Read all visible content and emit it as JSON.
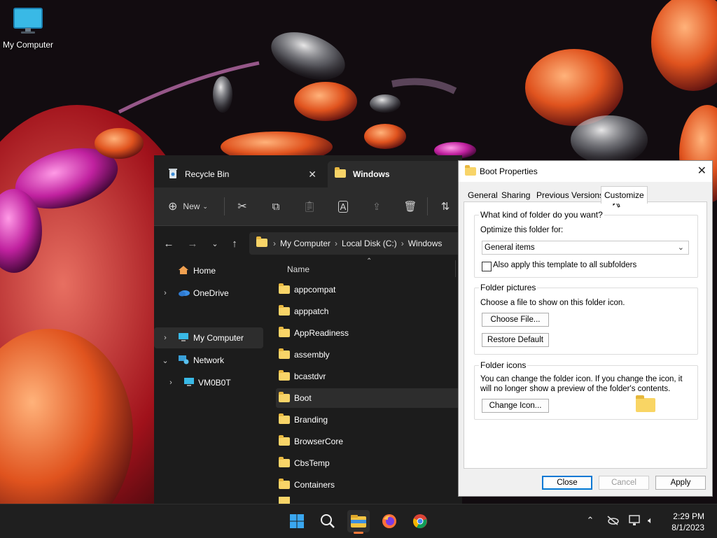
{
  "desktop": {
    "icon_label": "My Computer"
  },
  "explorer": {
    "tabs": [
      {
        "label": "Recycle Bin"
      },
      {
        "label": "Windows"
      }
    ],
    "toolbar": {
      "new_label": "New"
    },
    "address": {
      "crumbs": [
        "My Computer",
        "Local Disk (C:)",
        "Windows"
      ]
    },
    "nav": {
      "home": "Home",
      "onedrive": "OneDrive",
      "mycomputer": "My Computer",
      "network": "Network",
      "vm": "VM0B0T"
    },
    "list": {
      "header": "Name",
      "items": [
        "appcompat",
        "apppatch",
        "AppReadiness",
        "assembly",
        "bcastdvr",
        "Boot",
        "Branding",
        "BrowserCore",
        "CbsTemp",
        "Containers"
      ],
      "selected": "Boot"
    }
  },
  "dialog": {
    "title": "Boot Properties",
    "tabs": [
      "General",
      "Sharing",
      "Previous Versions",
      "Customize"
    ],
    "active_tab": "Customize",
    "type_group": {
      "label": "What kind of folder do you want?",
      "optimize_label": "Optimize this folder for:",
      "select_value": "General items",
      "checkbox_label": "Also apply this template to all subfolders",
      "checkbox_checked": false
    },
    "pictures_group": {
      "label": "Folder pictures",
      "desc": "Choose a file to show on this folder icon.",
      "choose_btn": "Choose File...",
      "restore_btn": "Restore Default"
    },
    "icons_group": {
      "label": "Folder icons",
      "desc": "You can change the folder icon. If you change the icon, it will no longer show a preview of the folder's contents.",
      "change_btn": "Change Icon..."
    },
    "buttons": {
      "close": "Close",
      "cancel": "Cancel",
      "apply": "Apply"
    }
  },
  "taskbar": {
    "apps": [
      "start-icon",
      "search-icon",
      "file-explorer-icon",
      "firefox-icon",
      "chrome-icon"
    ],
    "clock": {
      "time": "2:29 PM",
      "date": "8/1/2023"
    }
  }
}
